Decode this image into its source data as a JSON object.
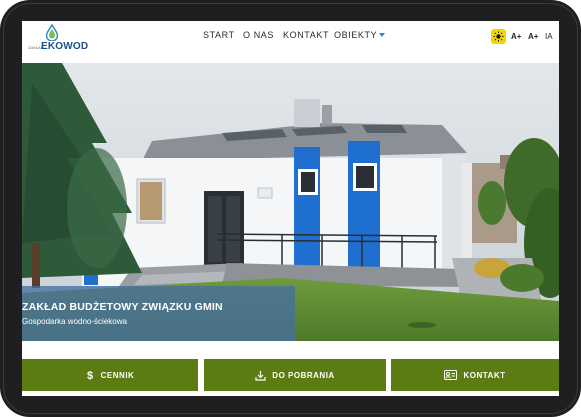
{
  "header": {
    "logo_small": "ZAKŁAD",
    "logo_text": "EKOWOD",
    "nav": [
      {
        "label": "START"
      },
      {
        "label": "O NAS"
      },
      {
        "label": "KONTAKT"
      },
      {
        "label": "OBIEKTY"
      }
    ],
    "accessibility": {
      "font_plus": "A+",
      "font_plus_plus": "A+",
      "spacing": "IA"
    }
  },
  "hero": {
    "title": "ZAKŁAD BUDŻETOWY ZWIĄZKU GMIN",
    "subtitle": "Gospodarka wodno-ściekowa"
  },
  "buttons": [
    {
      "label": "CENNIK",
      "icon": "dollar-icon"
    },
    {
      "label": "DO POBRANIA",
      "icon": "download-icon"
    },
    {
      "label": "KONTAKT",
      "icon": "contact-card-icon"
    }
  ],
  "colors": {
    "accent_green": "#5b7c13",
    "accent_blue": "#2a87c9",
    "building_blue": "#1f6fd0",
    "contrast_yellow": "#f2d600"
  }
}
